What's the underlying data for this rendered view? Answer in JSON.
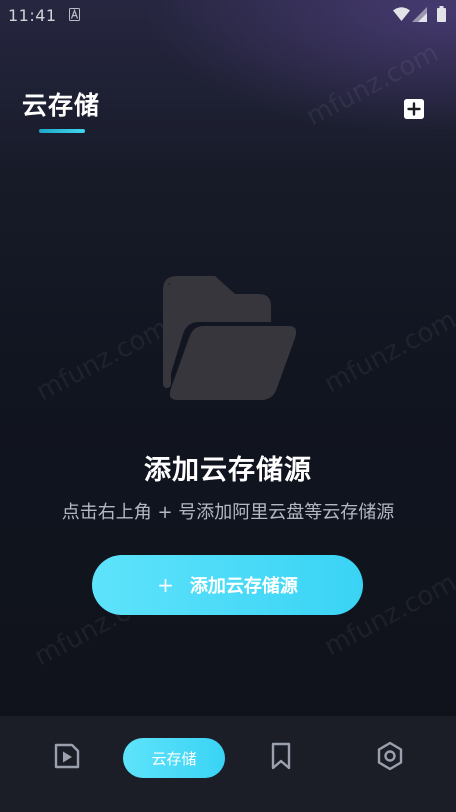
{
  "status_bar": {
    "time": "11:41",
    "icons": [
      "app-a-icon",
      "wifi-icon",
      "signal-icon",
      "battery-icon"
    ]
  },
  "header": {
    "title": "云存储",
    "add_icon": "plus-square-icon"
  },
  "empty_state": {
    "icon": "folder-open-icon",
    "title": "添加云存储源",
    "subtitle": "点击右上角 + 号添加阿里云盘等云存储源",
    "button_plus": "+",
    "button_label": "添加云存储源"
  },
  "watermark": "mfunz.com",
  "bottom_nav": {
    "items": [
      {
        "icon": "play-tile-icon"
      },
      {
        "label": "云存储",
        "active": true
      },
      {
        "icon": "bookmark-icon"
      },
      {
        "icon": "hexagon-settings-icon"
      }
    ]
  },
  "colors": {
    "accent": "#3ad3f5",
    "accent_light": "#5ee3fb",
    "background": "#111520",
    "nav_background": "#1b1e26",
    "folder_icon": "#36363c"
  }
}
